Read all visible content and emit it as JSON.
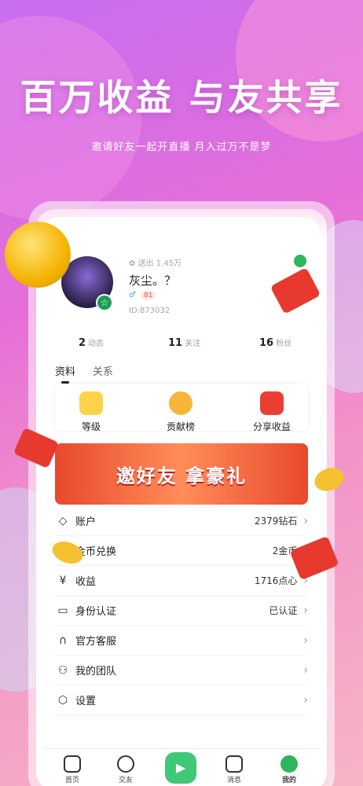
{
  "hero": {
    "title": "百万收益 与友共享",
    "subtitle": "邀请好友一起开直播  月入过万不是梦"
  },
  "profile": {
    "sent_label": "送出 1.45万",
    "name": "灰尘。？",
    "level_badge": "81",
    "id_text": "ID:873032"
  },
  "stats": [
    {
      "value": "2",
      "label": "动态"
    },
    {
      "value": "11",
      "label": "关注"
    },
    {
      "value": "16",
      "label": "粉丝"
    }
  ],
  "tabs": [
    {
      "label": "资料",
      "active": true
    },
    {
      "label": "关系",
      "active": false
    }
  ],
  "quick_actions": [
    {
      "label": "等级",
      "icon": "crown-icon"
    },
    {
      "label": "贡献榜",
      "icon": "medal-icon"
    },
    {
      "label": "分享收益",
      "icon": "red-envelope-icon"
    }
  ],
  "banner": {
    "text": "邀好友 拿豪礼"
  },
  "menu": [
    {
      "label": "账户",
      "value": "2379钻石",
      "icon": "diamond-icon"
    },
    {
      "label": "金币兑换",
      "value": "2金币",
      "icon": "coins-icon"
    },
    {
      "label": "收益",
      "value": "1716点心",
      "icon": "yen-icon"
    },
    {
      "label": "身份认证",
      "value": "已认证",
      "icon": "id-card-icon"
    },
    {
      "label": "官方客服",
      "value": "",
      "icon": "headset-icon"
    },
    {
      "label": "我的团队",
      "value": "",
      "icon": "team-icon"
    },
    {
      "label": "设置",
      "value": "",
      "icon": "settings-icon"
    }
  ],
  "nav": [
    {
      "label": "首页",
      "icon": "home-icon"
    },
    {
      "label": "交友",
      "icon": "star-icon"
    },
    {
      "label": "",
      "icon": "play-icon"
    },
    {
      "label": "消息",
      "icon": "message-icon"
    },
    {
      "label": "我的",
      "icon": "profile-icon"
    }
  ],
  "colors": {
    "accent": "#e85dd4",
    "green": "#1d9c57",
    "banner_red": "#e8492b"
  }
}
